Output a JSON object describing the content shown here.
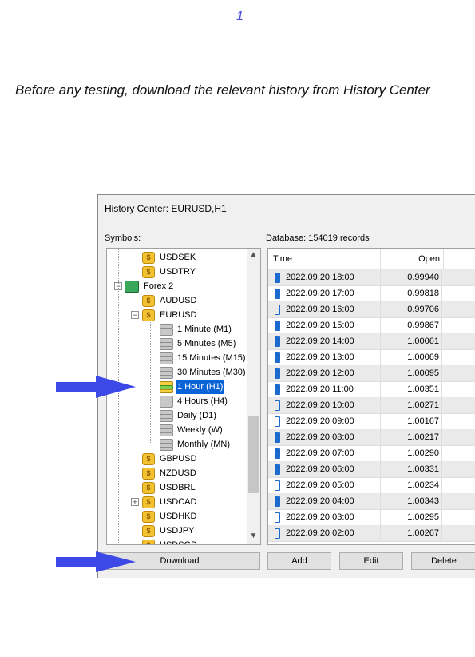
{
  "page_number": "1",
  "caption": "Before any testing, download the relevant history from History Center",
  "dialog": {
    "title": "History Center: EURUSD,H1",
    "symbols_label": "Symbols:",
    "database_label": "Database: 154019 records"
  },
  "tree": [
    {
      "label": "USDSEK",
      "type": "symbol"
    },
    {
      "label": "USDTRY",
      "type": "symbol"
    },
    {
      "label": "Forex 2",
      "type": "folder"
    },
    {
      "label": "AUDUSD",
      "type": "symbol"
    },
    {
      "label": "EURUSD",
      "type": "symbol"
    },
    {
      "label": "1 Minute (M1)",
      "type": "timeframe"
    },
    {
      "label": "5 Minutes (M5)",
      "type": "timeframe"
    },
    {
      "label": "15 Minutes (M15)",
      "type": "timeframe"
    },
    {
      "label": "30 Minutes (M30)",
      "type": "timeframe"
    },
    {
      "label": "1 Hour (H1)",
      "type": "timeframe",
      "selected": true
    },
    {
      "label": "4 Hours (H4)",
      "type": "timeframe"
    },
    {
      "label": "Daily (D1)",
      "type": "timeframe"
    },
    {
      "label": "Weekly (W)",
      "type": "timeframe"
    },
    {
      "label": "Monthly (MN)",
      "type": "timeframe"
    },
    {
      "label": "GBPUSD",
      "type": "symbol"
    },
    {
      "label": "NZDUSD",
      "type": "symbol"
    },
    {
      "label": "USDBRL",
      "type": "symbol"
    },
    {
      "label": "USDCAD",
      "type": "symbol"
    },
    {
      "label": "USDHKD",
      "type": "symbol"
    },
    {
      "label": "USDJPY",
      "type": "symbol"
    },
    {
      "label": "USDSGD",
      "type": "symbol"
    }
  ],
  "grid": {
    "columns": [
      "Time",
      "Open"
    ],
    "rows": [
      {
        "time": "2022.09.20 18:00",
        "open": "0.99940",
        "bull": false
      },
      {
        "time": "2022.09.20 17:00",
        "open": "0.99818",
        "bull": false
      },
      {
        "time": "2022.09.20 16:00",
        "open": "0.99706",
        "bull": true
      },
      {
        "time": "2022.09.20 15:00",
        "open": "0.99867",
        "bull": false
      },
      {
        "time": "2022.09.20 14:00",
        "open": "1.00061",
        "bull": false
      },
      {
        "time": "2022.09.20 13:00",
        "open": "1.00069",
        "bull": false
      },
      {
        "time": "2022.09.20 12:00",
        "open": "1.00095",
        "bull": false
      },
      {
        "time": "2022.09.20 11:00",
        "open": "1.00351",
        "bull": false
      },
      {
        "time": "2022.09.20 10:00",
        "open": "1.00271",
        "bull": true
      },
      {
        "time": "2022.09.20 09:00",
        "open": "1.00167",
        "bull": true
      },
      {
        "time": "2022.09.20 08:00",
        "open": "1.00217",
        "bull": false
      },
      {
        "time": "2022.09.20 07:00",
        "open": "1.00290",
        "bull": false
      },
      {
        "time": "2022.09.20 06:00",
        "open": "1.00331",
        "bull": false
      },
      {
        "time": "2022.09.20 05:00",
        "open": "1.00234",
        "bull": true
      },
      {
        "time": "2022.09.20 04:00",
        "open": "1.00343",
        "bull": false
      },
      {
        "time": "2022.09.20 03:00",
        "open": "1.00295",
        "bull": true
      },
      {
        "time": "2022.09.20 02:00",
        "open": "1.00267",
        "bull": true
      }
    ]
  },
  "buttons": {
    "download": "Download",
    "add": "Add",
    "edit": "Edit",
    "delete": "Delete"
  },
  "colors": {
    "arrow": "#3d49e6",
    "selection": "#0a64d8"
  }
}
